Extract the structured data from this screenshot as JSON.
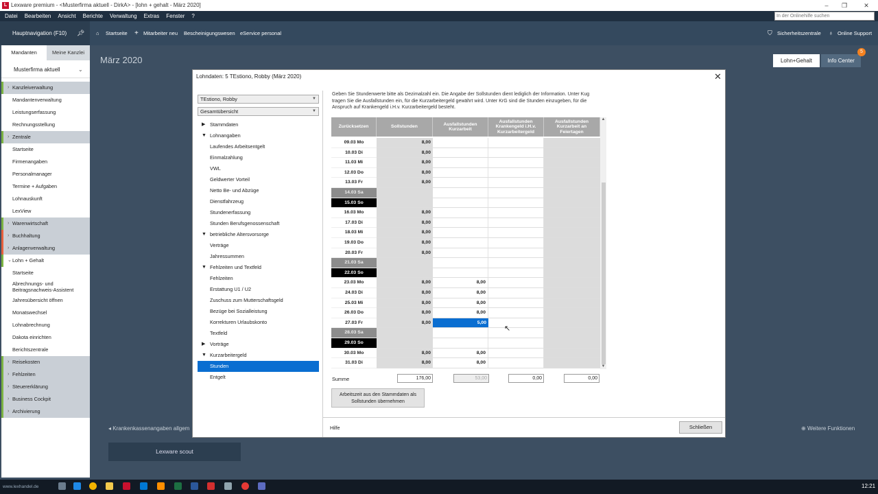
{
  "window": {
    "title": "Lexware premium - <Musterfirma aktuell - DirkA> - [lohn + gehalt - März 2020]"
  },
  "menu": [
    "Datei",
    "Bearbeiten",
    "Ansicht",
    "Berichte",
    "Verwaltung",
    "Extras",
    "Fenster",
    "?"
  ],
  "help_search": {
    "placeholder": "In der Onlinehilfe suchen"
  },
  "toolbar": {
    "nav_label": "Hauptnavigation (F10)",
    "items": [
      "Startseite",
      "Mitarbeiter neu",
      "Bescheinigungswesen",
      "eService personal"
    ],
    "right": [
      "Sicherheitszentrale",
      "Online Support"
    ]
  },
  "sidebar": {
    "tabs": [
      "Mandanten",
      "Meine Kanzlei"
    ],
    "firm": "Musterfirma aktuell",
    "items": [
      {
        "label": "Kanzleiverwaltung",
        "group": true,
        "color": "#7cb342"
      },
      {
        "label": "Mandantenverwaltung"
      },
      {
        "label": "Leistungserfassung"
      },
      {
        "label": "Rechnungsstellung"
      },
      {
        "label": "Zentrale",
        "group": true,
        "color": "#7cb342"
      },
      {
        "label": "Startseite"
      },
      {
        "label": "Firmenangaben"
      },
      {
        "label": "Personalmanager"
      },
      {
        "label": "Termine + Aufgaben"
      },
      {
        "label": "Lohnauskunft"
      },
      {
        "label": "LexView"
      },
      {
        "label": "Warenwirtschaft",
        "group": true,
        "color": "#7cb342"
      },
      {
        "label": "Buchhaltung",
        "group": true,
        "color": "#e8603c"
      },
      {
        "label": "Anlagenverwaltung",
        "group": true,
        "color": "#e8603c"
      },
      {
        "label": "Lohn + Gehalt",
        "group": true,
        "open": true,
        "color": "#7cb342"
      },
      {
        "label": "Startseite"
      },
      {
        "label": "Abrechnungs- und Beitragsnachweis-Assistent",
        "double": true
      },
      {
        "label": "Jahresübersicht öffnen"
      },
      {
        "label": "Monatswechsel"
      },
      {
        "label": "Lohnabrechnung"
      },
      {
        "label": "Dakota einrichten"
      },
      {
        "label": "Berichtszentrale"
      },
      {
        "label": "Reisekosten",
        "group": true,
        "color": "#7cb342"
      },
      {
        "label": "Fehlzeiten",
        "group": true,
        "color": "#7cb342"
      },
      {
        "label": "Steuererklärung",
        "group": true,
        "color": "#7cb342"
      },
      {
        "label": "Business Cockpit",
        "group": true,
        "color": "#7cb342"
      },
      {
        "label": "Archivierung",
        "group": true,
        "color": "#7cb342"
      }
    ]
  },
  "main": {
    "month": "März 2020",
    "btn_lohn": "Lohn+Gehalt",
    "btn_info": "Info Center",
    "badge": "5",
    "kk_link": "Krankenkassenangaben allgem",
    "weitere": "Weitere Funktionen",
    "scout": "Lexware scout"
  },
  "dialog": {
    "title": "Lohndaten: 5 TEstiono, Robby (März 2020)",
    "employee": "TEstiono, Robby",
    "view": "Gesamtübersicht",
    "tree": [
      {
        "label": "Stammdaten",
        "level": 0,
        "tri": "▶"
      },
      {
        "label": "Lohnangaben",
        "level": 0,
        "tri": "▼"
      },
      {
        "label": "Laufendes Arbeitsentgelt",
        "level": 1
      },
      {
        "label": "Einmalzahlung",
        "level": 1
      },
      {
        "label": "VWL",
        "level": 1
      },
      {
        "label": "Geldwerter Vorteil",
        "level": 1
      },
      {
        "label": "Netto Be- und Abzüge",
        "level": 1
      },
      {
        "label": "Dienstfahrzeug",
        "level": 1
      },
      {
        "label": "Stundenerfassung",
        "level": 1
      },
      {
        "label": "Stunden Berufsgenossenschaft",
        "level": 1
      },
      {
        "label": "betriebliche Altersvorsorge",
        "level": 0,
        "tri": "▼"
      },
      {
        "label": "Verträge",
        "level": 1
      },
      {
        "label": "Jahressummen",
        "level": 1
      },
      {
        "label": "Fehlzeiten und Textfeld",
        "level": 0,
        "tri": "▼"
      },
      {
        "label": "Fehlzeiten",
        "level": 1
      },
      {
        "label": "Erstattung U1 / U2",
        "level": 1
      },
      {
        "label": "Zuschuss zum Mutterschaftsgeld",
        "level": 1
      },
      {
        "label": "Bezüge bei Sozialleistung",
        "level": 1
      },
      {
        "label": "Korrekturen Urlaubskonto",
        "level": 1
      },
      {
        "label": "Textfeld",
        "level": 1
      },
      {
        "label": "Vorträge",
        "level": 0,
        "tri": "▶"
      },
      {
        "label": "Kurzarbeitergeld",
        "level": 0,
        "tri": "▼"
      },
      {
        "label": "Stunden",
        "level": 1,
        "selected": true
      },
      {
        "label": "Entgelt",
        "level": 1
      }
    ],
    "info": "Geben Sie Stundenwerte bitte als Dezimalzahl ein. Die Angabe der Sollstunden dient lediglich der Information. Unter Kug tragen Sie die Ausfallstunden ein, für die Kurzarbeitergeld gewährt wird. Unter KrG sind die Stunden einzugeben, für die Anspruch auf Krankengeld i.H.v. Kurzarbeitergeld besteht.",
    "columns": [
      "Zurücksetzen",
      "Sollstunden",
      "Ausfallstunden Kurzarbeit",
      "Ausfallstunden Krankengeld i.H.v. Kurzarbeitergeld",
      "Ausfallstunden Kurzarbeit an Feiertagen"
    ],
    "rows": [
      {
        "date": "09.03 Mo",
        "soll": "8,00",
        "kug": ""
      },
      {
        "date": "10.03 Di",
        "soll": "8,00",
        "kug": ""
      },
      {
        "date": "11.03 Mi",
        "soll": "8,00",
        "kug": ""
      },
      {
        "date": "12.03 Do",
        "soll": "8,00",
        "kug": ""
      },
      {
        "date": "13.03 Fr",
        "soll": "8,00",
        "kug": ""
      },
      {
        "date": "14.03 Sa",
        "soll": "",
        "kug": "",
        "type": "sa"
      },
      {
        "date": "15.03 So",
        "soll": "",
        "kug": "",
        "type": "so"
      },
      {
        "date": "16.03 Mo",
        "soll": "8,00",
        "kug": ""
      },
      {
        "date": "17.03 Di",
        "soll": "8,00",
        "kug": ""
      },
      {
        "date": "18.03 Mi",
        "soll": "8,00",
        "kug": ""
      },
      {
        "date": "19.03 Do",
        "soll": "8,00",
        "kug": ""
      },
      {
        "date": "20.03 Fr",
        "soll": "8,00",
        "kug": ""
      },
      {
        "date": "21.03 Sa",
        "soll": "",
        "kug": "",
        "type": "sa"
      },
      {
        "date": "22.03 So",
        "soll": "",
        "kug": "",
        "type": "so"
      },
      {
        "date": "23.03 Mo",
        "soll": "8,00",
        "kug": "8,00"
      },
      {
        "date": "24.03 Di",
        "soll": "8,00",
        "kug": "8,00"
      },
      {
        "date": "25.03 Mi",
        "soll": "8,00",
        "kug": "8,00"
      },
      {
        "date": "26.03 Do",
        "soll": "8,00",
        "kug": "8,00"
      },
      {
        "date": "27.03 Fr",
        "soll": "8,00",
        "kug": "5,00",
        "selected": true
      },
      {
        "date": "28.03 Sa",
        "soll": "",
        "kug": "",
        "type": "sa"
      },
      {
        "date": "29.03 So",
        "soll": "",
        "kug": "",
        "type": "so"
      },
      {
        "date": "30.03 Mo",
        "soll": "8,00",
        "kug": "8,00"
      },
      {
        "date": "31.03 Di",
        "soll": "8,00",
        "kug": "8,00"
      }
    ],
    "sum_label": "Summe",
    "sums": [
      "176,00",
      "53,00",
      "0,00",
      "0,00"
    ],
    "btn_arbeitszeit": "Arbeitszeit aus den Stammdaten als Sollstunden übernehmen",
    "hilfe": "Hilfe",
    "btn_close": "Schließen"
  },
  "taskbar": {
    "time": "12:21",
    "watermark": "www.lexhandel.de"
  }
}
